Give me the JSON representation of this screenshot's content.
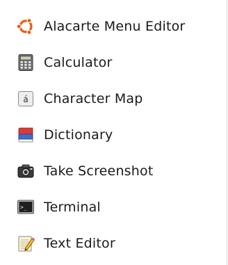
{
  "menu": {
    "items": [
      {
        "label": "Alacarte Menu Editor",
        "icon": "ubuntu-logo-icon"
      },
      {
        "label": "Calculator",
        "icon": "calculator-icon"
      },
      {
        "label": "Character Map",
        "icon": "character-map-icon"
      },
      {
        "label": "Dictionary",
        "icon": "dictionary-book-icon"
      },
      {
        "label": "Take Screenshot",
        "icon": "camera-icon"
      },
      {
        "label": "Terminal",
        "icon": "terminal-icon"
      },
      {
        "label": "Text Editor",
        "icon": "text-editor-icon"
      }
    ],
    "character_map_glyph": "á",
    "terminal_prompt_glyph": ">_"
  }
}
